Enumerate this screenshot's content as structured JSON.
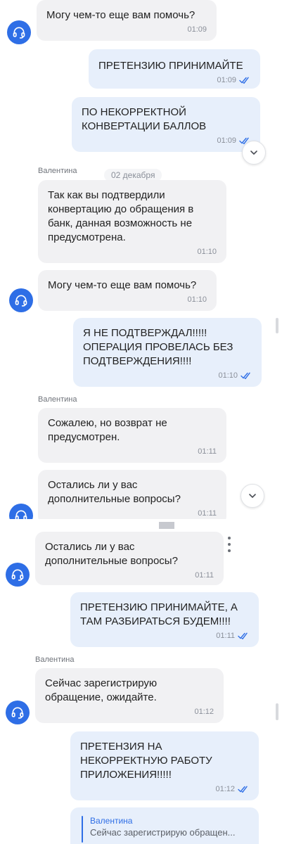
{
  "agent_name": "Валентина",
  "date_chip": "02 декабря",
  "messages": [
    {
      "dir": "in",
      "text": "Могу чем-то еще вам помочь?",
      "time": "01:09"
    },
    {
      "dir": "out",
      "text": "ПРЕТЕНЗИЮ ПРИНИМАЙТЕ",
      "time": "01:09"
    },
    {
      "dir": "out",
      "text": "ПО НЕКОРРЕКТНОЙ\nКОНВЕРТАЦИИ БАЛЛОВ",
      "time": "01:09"
    },
    {
      "dir": "in",
      "text": "Так как вы подтвердили\nконвертацию до обращения в\nбанк, данная возможность не\nпредусмотрена.",
      "time": "01:10"
    },
    {
      "dir": "in",
      "text": "Могу чем-то еще вам помочь?",
      "time": "01:10"
    },
    {
      "dir": "out",
      "text": "Я НЕ ПОДТВЕРЖДАЛ!!!!!\nОПЕРАЦИЯ ПРОВЕЛАСЬ БЕЗ\nПОДТВЕРЖДЕНИЯ!!!!",
      "time": "01:10"
    },
    {
      "dir": "in",
      "text": "Сожалею, но возврат не\nпредусмотрен.",
      "time": "01:11"
    },
    {
      "dir": "in",
      "text": "Остались ли у вас\nдополнительные вопросы?",
      "time": "01:11"
    },
    {
      "dir": "in",
      "text": "Остались ли у вас\nдополнительные вопросы?",
      "time": "01:11"
    },
    {
      "dir": "out",
      "text": "ПРЕТЕНЗИЮ ПРИНИМАЙТЕ, А\nТАМ РАЗБИРАТЬСЯ БУДЕМ!!!!",
      "time": "01:11"
    },
    {
      "dir": "in",
      "text": "Сейчас зарегистрирую\nобращение, ожидайте.",
      "time": "01:12"
    },
    {
      "dir": "out",
      "text": "ПРЕТЕНЗИЯ НА\nНЕКОРРЕКТНУЮ РАБОТУ\nПРИЛОЖЕНИЯ!!!!!",
      "time": "01:12"
    }
  ],
  "reply_quote": {
    "name": "Валентина",
    "text": "Сейчас зарегистрирую обращен..."
  },
  "icons": {
    "avatar": "headset-icon",
    "scroll": "chevron-down-icon",
    "read": "double-check-icon",
    "menu": "more-vertical-icon"
  },
  "colors": {
    "accent": "#2e6ee6",
    "incoming": "#f1f1f3",
    "outgoing": "#e7effb"
  }
}
